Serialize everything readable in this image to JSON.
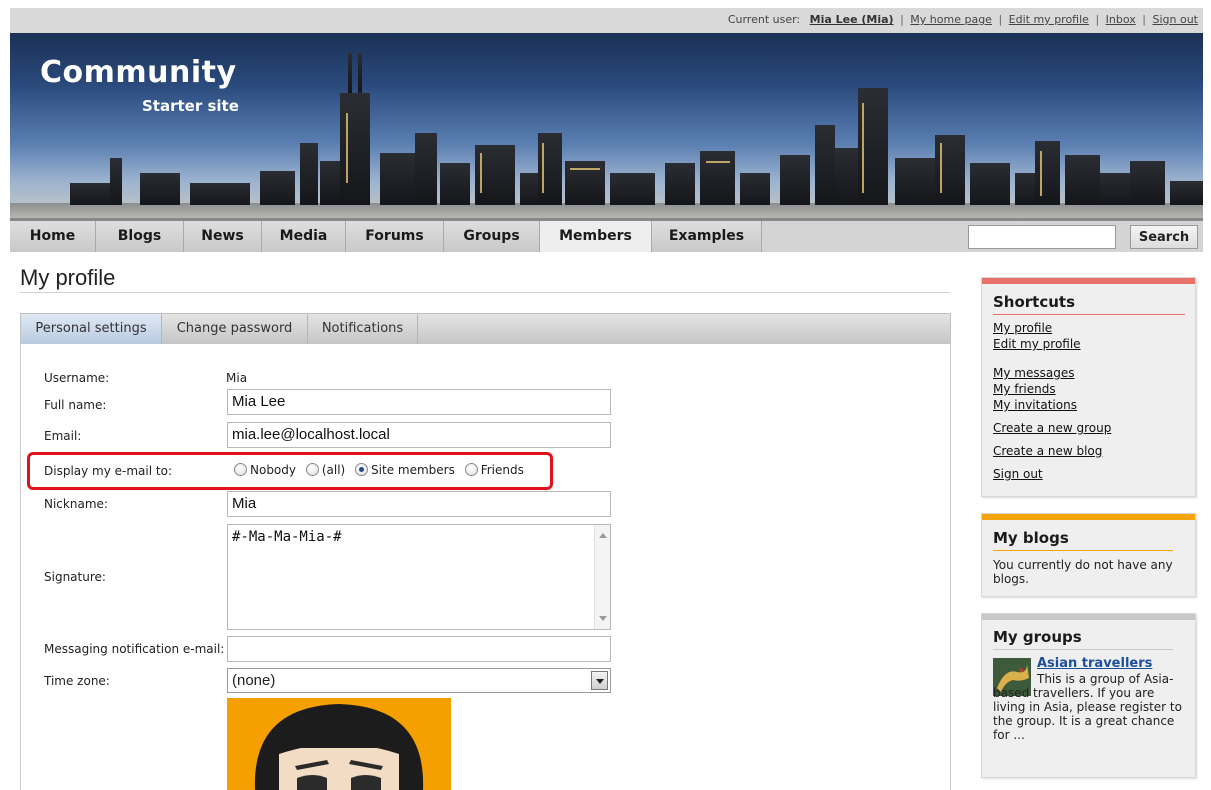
{
  "userbar": {
    "label": "Current user:",
    "name": "Mia Lee (Mia)",
    "links": [
      "My home page",
      "Edit my profile",
      "Inbox",
      "Sign out"
    ]
  },
  "header": {
    "logo_main": "Community",
    "logo_sub": "Starter site"
  },
  "nav": {
    "items": [
      "Home",
      "Blogs",
      "News",
      "Media",
      "Forums",
      "Groups",
      "Members",
      "Examples"
    ],
    "active": "Members",
    "search_value": "",
    "search_button": "Search"
  },
  "page": {
    "title": "My profile"
  },
  "tabs": [
    "Personal settings",
    "Change password",
    "Notifications"
  ],
  "form": {
    "username_label": "Username:",
    "username_value": "Mia",
    "fullname_label": "Full name:",
    "fullname_value": "Mia Lee",
    "email_label": "Email:",
    "email_value": "mia.lee@localhost.local",
    "display_label": "Display my e-mail to:",
    "display_options": [
      "Nobody",
      "(all)",
      "Site members",
      "Friends"
    ],
    "display_selected": "Site members",
    "nickname_label": "Nickname:",
    "nickname_value": "Mia",
    "signature_label": "Signature:",
    "signature_value": "#-Ma-Ma-Mia-#",
    "msg_email_label": "Messaging notification e-mail:",
    "msg_email_value": "",
    "timezone_label": "Time zone:",
    "timezone_value": "(none)"
  },
  "sidebar": {
    "shortcuts": {
      "title": "Shortcuts",
      "stripe_color": "#e8716a",
      "links": [
        "My profile",
        "Edit my profile",
        "My messages",
        "My friends",
        "My invitations",
        "Create a new group",
        "Create a new blog",
        "Sign out"
      ]
    },
    "blogs": {
      "title": "My blogs",
      "stripe_color": "#f5a30a",
      "text": "You currently do not have any blogs."
    },
    "groups": {
      "title": "My groups",
      "stripe_color": "#c8c8c8",
      "group_name": "Asian travellers",
      "group_desc": "This is a group of Asia-based travellers. If you are living in Asia, please register to the group. It is a great chance for ..."
    }
  },
  "colors": {
    "highlight": "#e3111c",
    "link": "#1e4f9c"
  }
}
